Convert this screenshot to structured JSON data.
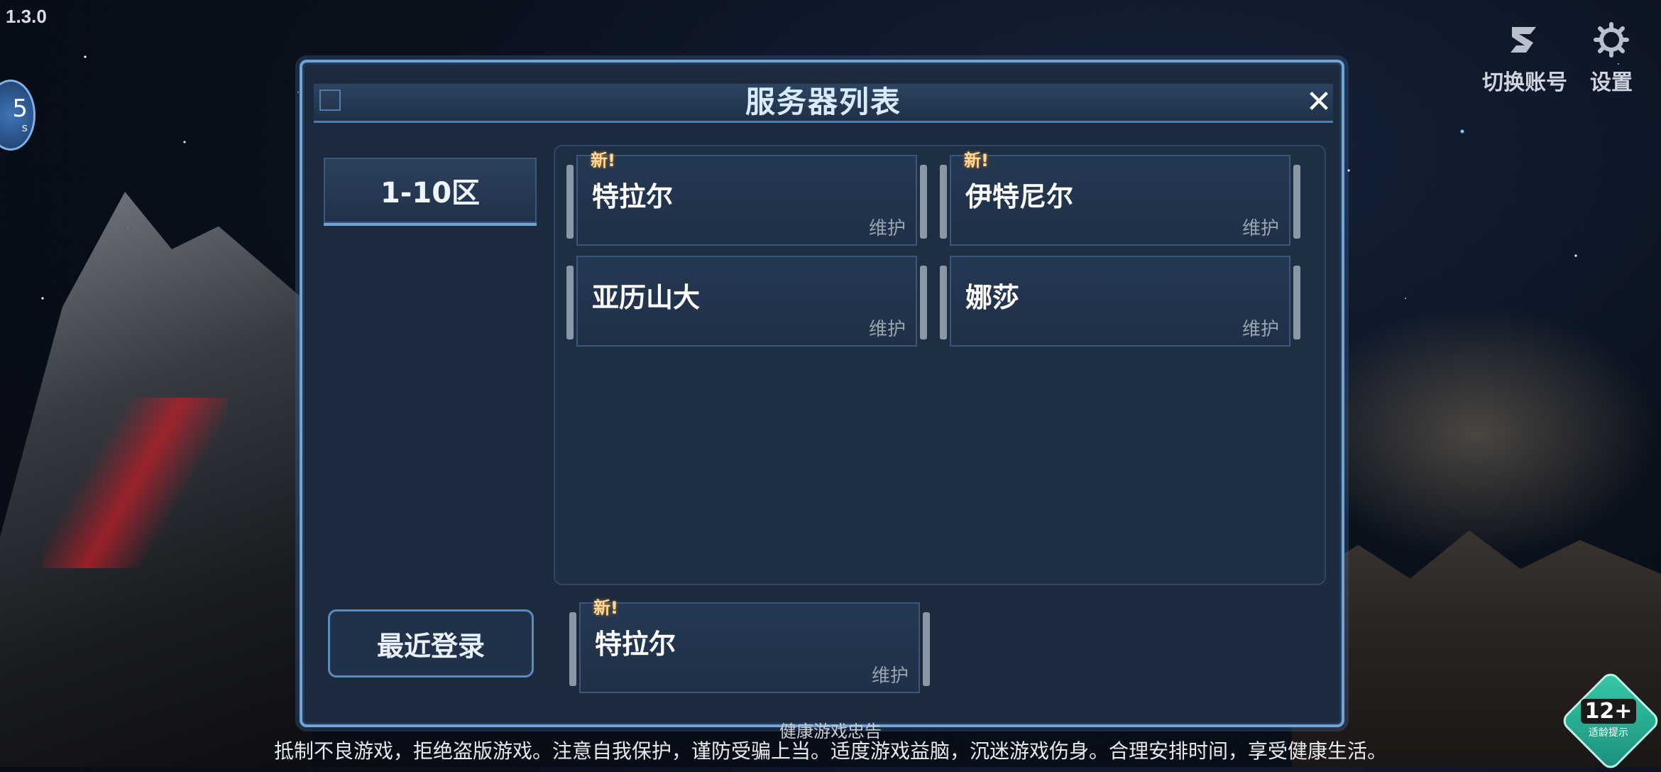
{
  "app": {
    "version": "1.3.0"
  },
  "fps": {
    "value": "5",
    "unit": "s"
  },
  "top_actions": {
    "switch_account_label": "切换账号",
    "settings_label": "设置"
  },
  "modal": {
    "title": "服务器列表",
    "close_glyph": "✕",
    "zone_tab_label": "1-10区",
    "recent_login_label": "最近登录",
    "servers": [
      {
        "name": "特拉尔",
        "status": "维护",
        "tag": "新!"
      },
      {
        "name": "伊特尼尔",
        "status": "维护",
        "tag": "新!"
      },
      {
        "name": "亚历山大",
        "status": "维护",
        "tag": ""
      },
      {
        "name": "娜莎",
        "status": "维护",
        "tag": ""
      }
    ],
    "recent_server": {
      "name": "特拉尔",
      "status": "维护",
      "tag": "新!"
    }
  },
  "notice": {
    "title": "健康游戏忠告",
    "text": "抵制不良游戏，拒绝盗版游戏。注意自我保护，谨防受骗上当。适度游戏益脑，沉迷游戏伤身。合理安排时间，享受健康生活。"
  },
  "age_rating": {
    "label": "12+",
    "sub": "适龄提示"
  },
  "colors": {
    "accent": "#6fa4d6",
    "panel": "#1b2a3d",
    "new_tag": "#ffd89a",
    "status": "#9aa4b0"
  },
  "icons": {
    "switch_account": "logo-s-icon",
    "settings": "gear-icon",
    "close": "close-icon"
  }
}
